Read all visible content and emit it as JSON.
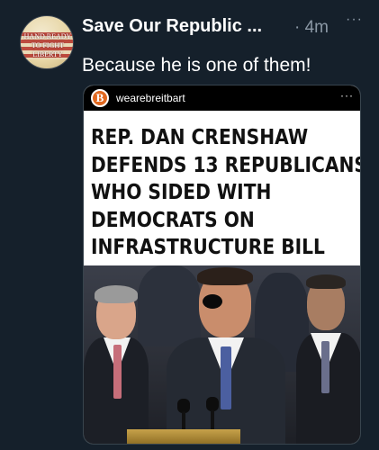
{
  "tweet": {
    "author_name": "Save Our Republic ...",
    "separator": "·",
    "time_ago": "4m",
    "more_icon": "more-horizontal-icon",
    "text": "Because he is one of them!",
    "avatar": {
      "line1": "HAND READY",
      "line2": "TO FIGHT",
      "line3": "LIBERTY"
    }
  },
  "embed": {
    "account_logo": "B",
    "account_handle": "wearebreitbart",
    "more_icon": "more-horizontal-icon",
    "headline_lines": [
      "REP. DAN CRENSHAW",
      "DEFENDS 13 REPUBLICANS",
      "WHO SIDED WITH",
      "DEMOCRATS ON",
      "INFRASTRUCTURE BILL"
    ]
  },
  "colors": {
    "background": "#15202b",
    "secondary_text": "#8b98a5",
    "breitbart_orange": "#e06820"
  }
}
